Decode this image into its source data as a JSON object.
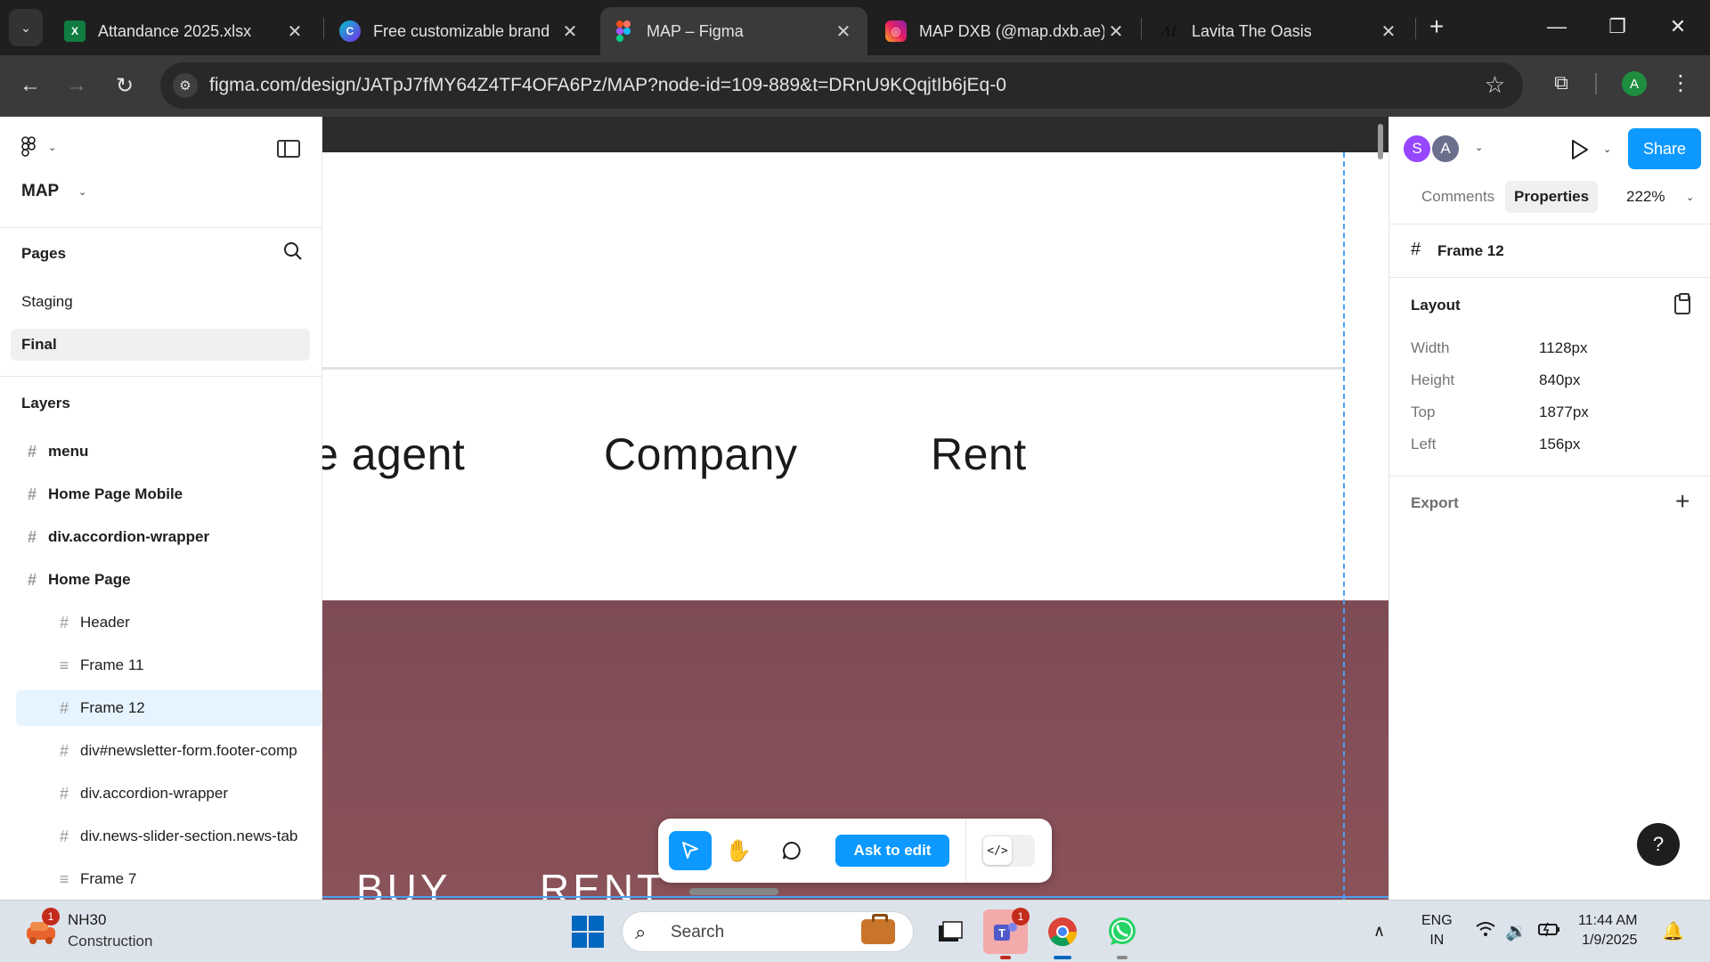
{
  "browser": {
    "tabs": [
      {
        "title": "Attandance 2025.xlsx",
        "favicon": "excel-icon",
        "active": false
      },
      {
        "title": "Free customizable brand",
        "favicon": "canva-icon",
        "active": false
      },
      {
        "title": "MAP – Figma",
        "favicon": "figma-icon",
        "active": true
      },
      {
        "title": "MAP DXB (@map.dxb.ae)",
        "favicon": "instagram-icon",
        "active": false
      },
      {
        "title": "Lavita The Oasis",
        "favicon": "lavita-icon",
        "active": false
      }
    ],
    "url": "figma.com/design/JATpJ7fMY64Z4TF4OFA6Pz/MAP?node-id=109-889&t=DRnU9KQqjtIb6jEq-0",
    "profile_initial": "A",
    "colors": {
      "tabbar": "#1f1f1f",
      "toolbar": "#3a3a3a"
    }
  },
  "figma": {
    "file_name": "MAP",
    "pages_title": "Pages",
    "pages": [
      {
        "label": "Staging",
        "selected": false
      },
      {
        "label": "Final",
        "selected": true
      }
    ],
    "layers_title": "Layers",
    "layers": [
      {
        "label": "menu",
        "icon": "frame-icon",
        "level": 0
      },
      {
        "label": "Home Page Mobile",
        "icon": "frame-icon",
        "level": 0
      },
      {
        "label": "div.accordion-wrapper",
        "icon": "frame-icon",
        "level": 0
      },
      {
        "label": "Home Page",
        "icon": "frame-icon",
        "level": 0
      },
      {
        "label": "Header",
        "icon": "frame-icon",
        "level": 1
      },
      {
        "label": "Frame 11",
        "icon": "autolayout-icon",
        "level": 1
      },
      {
        "label": "Frame 12",
        "icon": "frame-icon",
        "level": 1,
        "selected": true
      },
      {
        "label": "div#newsletter-form.footer-comp",
        "icon": "frame-icon",
        "level": 1
      },
      {
        "label": "div.accordion-wrapper",
        "icon": "frame-icon",
        "level": 1
      },
      {
        "label": "div.news-slider-section.news-tab",
        "icon": "frame-icon",
        "level": 1
      },
      {
        "label": "Frame 7",
        "icon": "autolayout-icon",
        "level": 1
      }
    ],
    "canvas": {
      "menu_items": [
        "e agent",
        "Company",
        "Rent"
      ],
      "footer_labels": [
        "BUY",
        "RENT"
      ],
      "colors": {
        "maroon": "#845058",
        "guide": "#4a9ff5"
      }
    },
    "bottom_toolbar": {
      "ask_to_edit": "Ask to edit",
      "dev_mode_icon": "</>"
    },
    "right_panel": {
      "collaborators": [
        {
          "initial": "S",
          "color": "#9747ff"
        },
        {
          "initial": "A",
          "color": "#6b6f8c"
        }
      ],
      "share_label": "Share",
      "tabs": [
        {
          "label": "Comments",
          "active": false
        },
        {
          "label": "Properties",
          "active": true
        }
      ],
      "zoom": "222%",
      "selection_name": "Frame 12",
      "layout_title": "Layout",
      "properties": [
        {
          "label": "Width",
          "value": "1128px"
        },
        {
          "label": "Height",
          "value": "840px"
        },
        {
          "label": "Top",
          "value": "1877px"
        },
        {
          "label": "Left",
          "value": "156px"
        }
      ],
      "export_title": "Export",
      "help_label": "?"
    }
  },
  "taskbar": {
    "weather_title": "NH30",
    "weather_sub": "Construction",
    "weather_badge": "1",
    "search_placeholder": "Search",
    "teams_badge": "1",
    "lang_top": "ENG",
    "lang_bottom": "IN",
    "time": "11:44 AM",
    "date": "1/9/2025"
  }
}
